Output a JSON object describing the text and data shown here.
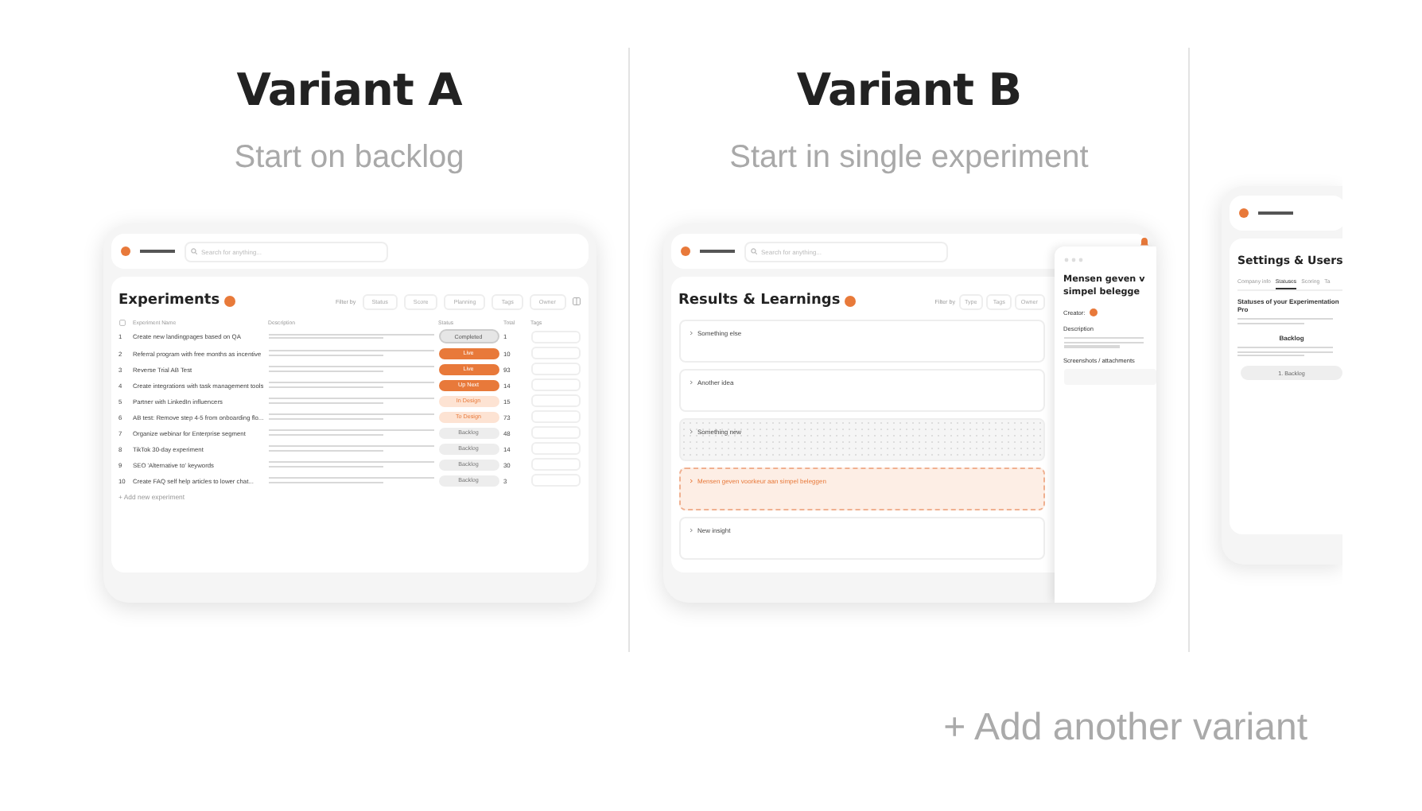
{
  "variants": [
    {
      "title": "Variant A",
      "subtitle": "Start on backlog",
      "preview": {
        "kind": "table",
        "search": {
          "placeholder": "Search for anything..."
        },
        "heading": "Experiments",
        "filter_label": "Filter by",
        "filters": [
          "Status",
          "Score",
          "Planning",
          "Tags",
          "Owner"
        ],
        "columns": [
          "Experiment Name",
          "Description",
          "Status",
          "Total",
          "Tags"
        ],
        "rows": [
          {
            "number": "1",
            "name": "Create new landingpages based on QA",
            "status": {
              "label": "Completed",
              "kind": "completed"
            },
            "total": "1"
          },
          {
            "number": "2",
            "name": "Referral program with free months as incentive",
            "status": {
              "label": "Live",
              "kind": "live"
            },
            "total": "10"
          },
          {
            "number": "3",
            "name": "Reverse Trial AB Test",
            "status": {
              "label": "Live",
              "kind": "live"
            },
            "total": "93"
          },
          {
            "number": "4",
            "name": "Create integrations with task management tools",
            "status": {
              "label": "Up Next",
              "kind": "live"
            },
            "total": "14"
          },
          {
            "number": "5",
            "name": "Partner with LinkedIn influencers",
            "status": {
              "label": "In Design",
              "kind": "design"
            },
            "total": "15"
          },
          {
            "number": "6",
            "name": "AB test: Remove step 4-5 from onboarding flo...",
            "status": {
              "label": "To Design",
              "kind": "design"
            },
            "total": "73"
          },
          {
            "number": "7",
            "name": "Organize webinar for Enterprise segment",
            "status": {
              "label": "Backlog",
              "kind": "backlog"
            },
            "total": "48"
          },
          {
            "number": "8",
            "name": "TikTok 30-day experiment",
            "status": {
              "label": "Backlog",
              "kind": "backlog"
            },
            "total": "14"
          },
          {
            "number": "9",
            "name": "SEO 'Alternative to' keywords",
            "status": {
              "label": "Backlog",
              "kind": "backlog"
            },
            "total": "30"
          },
          {
            "number": "10",
            "name": "Create FAQ self help articles to lower chat...",
            "status": {
              "label": "Backlog",
              "kind": "backlog"
            },
            "total": "3"
          }
        ],
        "add_row": "+ Add new experiment"
      }
    },
    {
      "title": "Variant B",
      "subtitle": "Start in single experiment",
      "preview": {
        "kind": "board",
        "search": {
          "placeholder": "Search for anything..."
        },
        "heading": "Results & Learnings",
        "filter_label": "Filter by",
        "filters": [
          "Type",
          "Tags",
          "Owner"
        ],
        "cards": [
          {
            "title": "Something else",
            "kind": "plain"
          },
          {
            "title": "Another idea",
            "kind": "plain"
          },
          {
            "title": "Something new",
            "kind": "dotted"
          },
          {
            "title": "Mensen geven voorkeur aan simpel beleggen",
            "kind": "highlight"
          },
          {
            "title": "New insight",
            "kind": "plain"
          }
        ],
        "panel": {
          "title_lines": [
            "Mensen geven v",
            "simpel belegge"
          ],
          "creator_label": "Creator:",
          "description_label": "Description",
          "attachments_label": "Screenshots / attachments"
        }
      }
    },
    {
      "preview": {
        "kind": "settings",
        "heading": "Settings & Users",
        "tabs": [
          {
            "label": "Company info",
            "selected": false
          },
          {
            "label": "Statuses",
            "selected": true
          },
          {
            "label": "Scoring",
            "selected": false
          },
          {
            "label": "Ta",
            "selected": false
          }
        ],
        "section_title": "Statuses of your Experimentation Pro",
        "status_title": "Backlog",
        "status_chip": "1. Backlog"
      }
    }
  ],
  "add_variant": "+ Add another variant"
}
